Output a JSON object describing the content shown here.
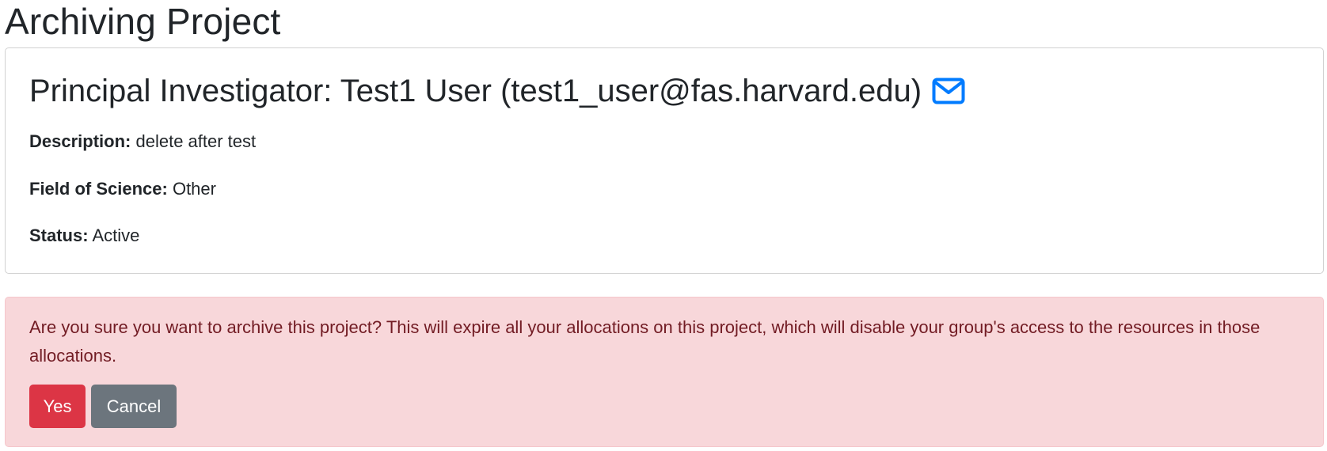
{
  "page": {
    "title": "Archiving Project"
  },
  "project": {
    "pi_heading": "Principal Investigator: Test1 User (test1_user@fas.harvard.edu)",
    "mail_icon": "envelope-icon",
    "fields": [
      {
        "label": "Description:",
        "value": "delete after test"
      },
      {
        "label": "Field of Science:",
        "value": "Other"
      },
      {
        "label": "Status:",
        "value": "Active"
      }
    ]
  },
  "alert": {
    "message": "Are you sure you want to archive this project? This will expire all your allocations on this project, which will disable your group's access to the resources in those allocations.",
    "yes_label": "Yes",
    "cancel_label": "Cancel"
  },
  "colors": {
    "mail_icon": "#007bff",
    "alert_bg": "#f8d7da",
    "alert_text": "#721c24",
    "yes_button": "#dc3545",
    "cancel_button": "#6c757d"
  }
}
